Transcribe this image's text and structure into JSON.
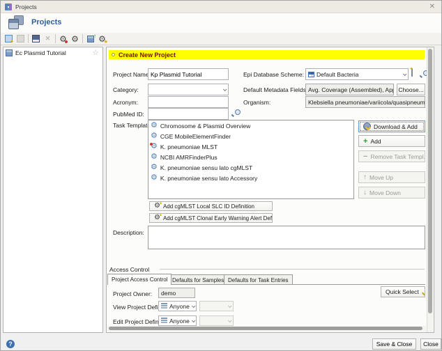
{
  "window": {
    "title": "Projects"
  },
  "icons": {
    "close": "✕",
    "star": "☆",
    "gear": "⚙",
    "arrow_up": "↑",
    "arrow_down": "↓",
    "plus": "+",
    "minus": "−",
    "help": "?",
    "delete_x": "✕"
  },
  "header": {
    "title": "Projects"
  },
  "toolbar": {
    "items": [
      "new-project",
      "duplicate-project",
      "save-project",
      "delete-project",
      "manage-task-templates",
      "modify-task-template",
      "import-project",
      "manage-plugins"
    ]
  },
  "sidebar": {
    "items": [
      {
        "label": "Ec Plasmid Tutorial"
      }
    ]
  },
  "form": {
    "banner": "Create New Project",
    "project_name": {
      "label": "Project Name:",
      "value": "Kp Plasmid Tutorial"
    },
    "category": {
      "label": "Category:",
      "value": ""
    },
    "acronym": {
      "label": "Acronym:",
      "value": ""
    },
    "pubmed_id": {
      "label": "PubMed ID:",
      "value": ""
    },
    "epi_database_scheme": {
      "label": "Epi Database Scheme:",
      "value": "Default Bacteria"
    },
    "default_metadata_fields": {
      "label": "Default Metadata Fields:",
      "value": "Avg. Coverage (Assembled), Approximated Ger",
      "choose_button": "Choose..."
    },
    "organism": {
      "label": "Organism:",
      "value": "Klebsiella pneumoniae/variicola/quasipneumoniae"
    },
    "task_templates": {
      "label": "Task Templates:",
      "items": [
        "Chromosome & Plasmid Overview",
        "CGE MobileElementFinder",
        "K. pneumoniae MLST",
        "NCBI AMRFinderPlus",
        "K. pneumoniae sensu lato cgMLST",
        "K. pneumoniae sensu lato Accessory"
      ]
    },
    "task_buttons": {
      "download_add": "Download & Add",
      "add": "Add",
      "remove": "Remove Task Templ...",
      "move_up": "Move Up",
      "move_down": "Move Down"
    },
    "cgmlst_buttons": {
      "local_slc": "Add cgMLST Local SLC ID Definition",
      "clonal_alert": "Add cgMLST Clonal Early Warning Alert Definitio..."
    },
    "description": {
      "label": "Description:",
      "value": ""
    }
  },
  "access_control": {
    "title": "Access Control",
    "tabs": [
      "Project Access Control",
      "Defaults for Samples",
      "Defaults for Task Entries"
    ],
    "active_tab": "Project Access Control",
    "project_owner": {
      "label": "Project Owner:",
      "value": "demo"
    },
    "view_project_definition": {
      "label": "View Project Definition:",
      "value": "Anyone"
    },
    "edit_project_definition": {
      "label": "Edit Project Definition:",
      "value": "Anyone"
    },
    "quick_select": "Quick Select"
  },
  "footer": {
    "save_close": "Save & Close",
    "close": "Close"
  },
  "colors": {
    "accent": "#2d5f9e",
    "banner_bg": "#ffff00",
    "banner_text": "#7b0d00",
    "focus": "#5e9ede"
  }
}
